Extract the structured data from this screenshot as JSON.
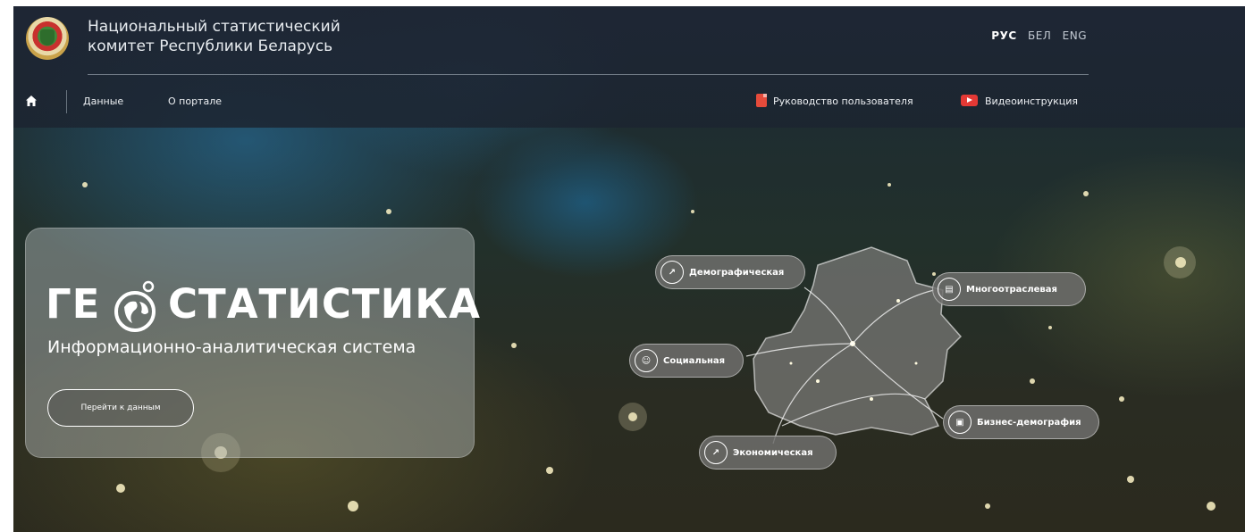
{
  "header": {
    "org_name_line1": "Национальный статистический",
    "org_name_line2": "комитет Республики Беларусь",
    "languages": [
      "РУС",
      "БЕЛ",
      "ENG"
    ]
  },
  "nav": {
    "items": [
      "Данные",
      "О портале"
    ],
    "user_guide": "Руководство пользователя",
    "video_guide": "Видеоинструкция"
  },
  "hero": {
    "brand_pre": "ГЕ",
    "brand_post": "СТАТИСТИКА",
    "tagline": "Информационно-аналитическая система",
    "button": "Перейти к данным"
  },
  "categories": [
    {
      "label": "Демографическая",
      "icon": "people-chart-icon"
    },
    {
      "label": "Многоотраслевая",
      "icon": "document-icon"
    },
    {
      "label": "Социальная",
      "icon": "group-icon"
    },
    {
      "label": "Бизнес-демография",
      "icon": "business-icon"
    },
    {
      "label": "Экономическая",
      "icon": "growth-chart-icon"
    }
  ]
}
